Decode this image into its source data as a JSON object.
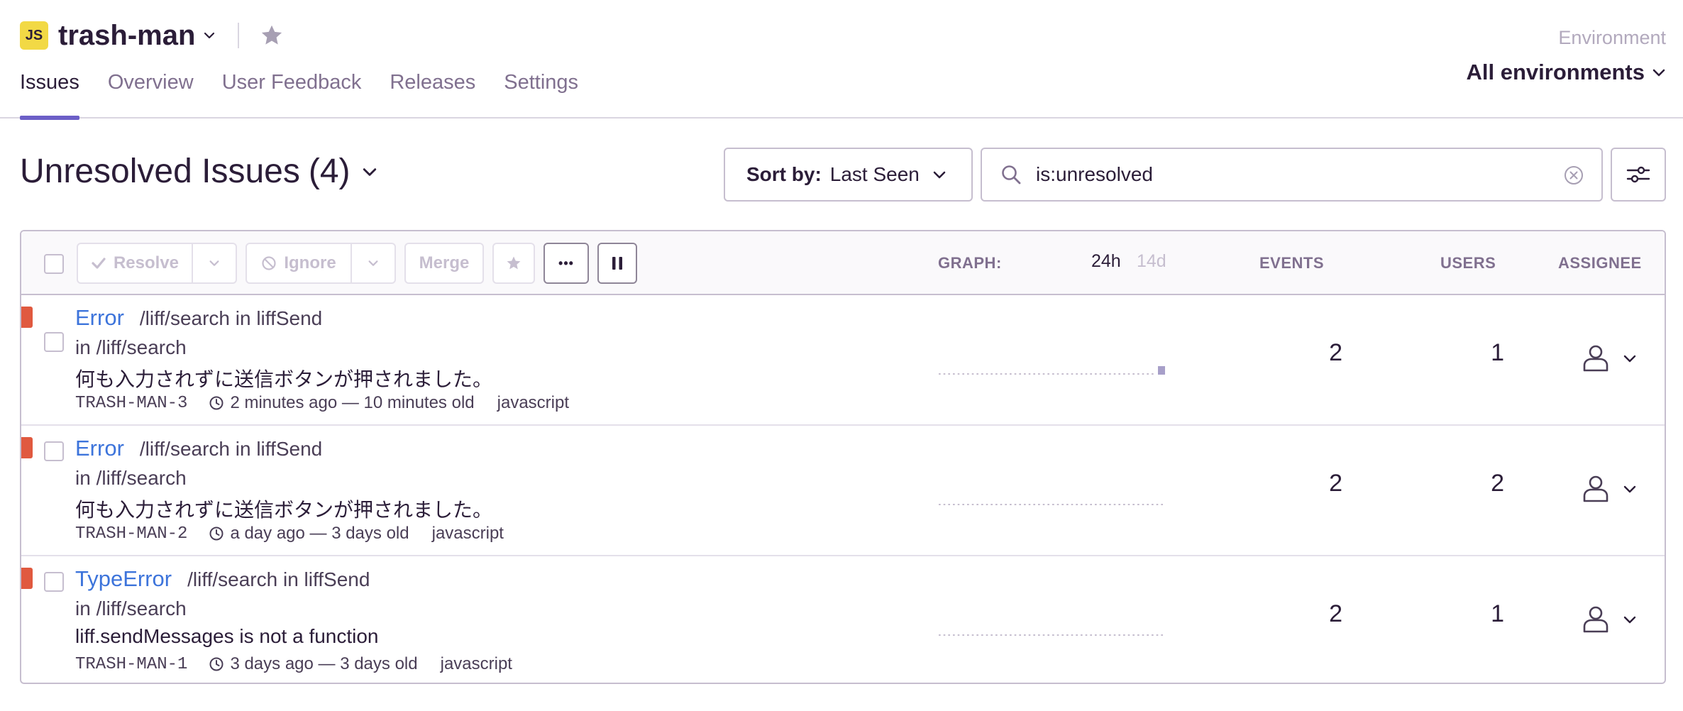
{
  "project": {
    "badge": "JS",
    "name": "trash-man"
  },
  "tabs": [
    {
      "label": "Issues",
      "active": true
    },
    {
      "label": "Overview",
      "active": false
    },
    {
      "label": "User Feedback",
      "active": false
    },
    {
      "label": "Releases",
      "active": false
    },
    {
      "label": "Settings",
      "active": false
    }
  ],
  "environment": {
    "label": "Environment",
    "value": "All environments"
  },
  "page": {
    "title": "Unresolved Issues",
    "count": "(4)"
  },
  "sort": {
    "label": "Sort by:",
    "value": "Last Seen"
  },
  "search": {
    "value": "is:unresolved"
  },
  "toolbar": {
    "resolve": "Resolve",
    "ignore": "Ignore",
    "merge": "Merge",
    "more": "•••"
  },
  "columns": {
    "graph": "GRAPH:",
    "graph_24h": "24h",
    "graph_14d": "14d",
    "events": "EVENTS",
    "users": "USERS",
    "assignee": "ASSIGNEE"
  },
  "issues": [
    {
      "type": "Error",
      "location": "/liff/search in liffSend",
      "culprit": "in /liff/search",
      "message": "何も入力されずに送信ボタンが押されました。",
      "short_id": "TRASH-MAN-3",
      "age": "2 minutes ago — 10 minutes old",
      "platform": "javascript",
      "events": "2",
      "users": "1",
      "sparkline": [
        0,
        0,
        0,
        0,
        0,
        0,
        0,
        0,
        0,
        0,
        0,
        0,
        0,
        0,
        0,
        0,
        0,
        0,
        0,
        0,
        0,
        0,
        0,
        2
      ]
    },
    {
      "type": "Error",
      "location": "/liff/search in liffSend",
      "culprit": "in /liff/search",
      "message": "何も入力されずに送信ボタンが押されました。",
      "short_id": "TRASH-MAN-2",
      "age": "a day ago — 3 days old",
      "platform": "javascript",
      "events": "2",
      "users": "2",
      "sparkline": [
        0,
        0,
        0,
        0,
        0,
        0,
        0,
        0,
        0,
        0,
        0,
        0,
        0,
        0,
        0,
        0,
        0,
        0,
        0,
        0,
        0,
        0,
        0,
        0
      ]
    },
    {
      "type": "TypeError",
      "location": "/liff/search in liffSend",
      "culprit": "in /liff/search",
      "message": "liff.sendMessages is not a function",
      "short_id": "TRASH-MAN-1",
      "age": "3 days ago — 3 days old",
      "platform": "javascript",
      "events": "2",
      "users": "1",
      "sparkline": [
        0,
        0,
        0,
        0,
        0,
        0,
        0,
        0,
        0,
        0,
        0,
        0,
        0,
        0,
        0,
        0,
        0,
        0,
        0,
        0,
        0,
        0,
        0,
        0
      ]
    }
  ],
  "colors": {
    "accent": "#6c5fc7",
    "link": "#3d74db",
    "error_level": "#e0593f",
    "badge": "#f2d945"
  }
}
